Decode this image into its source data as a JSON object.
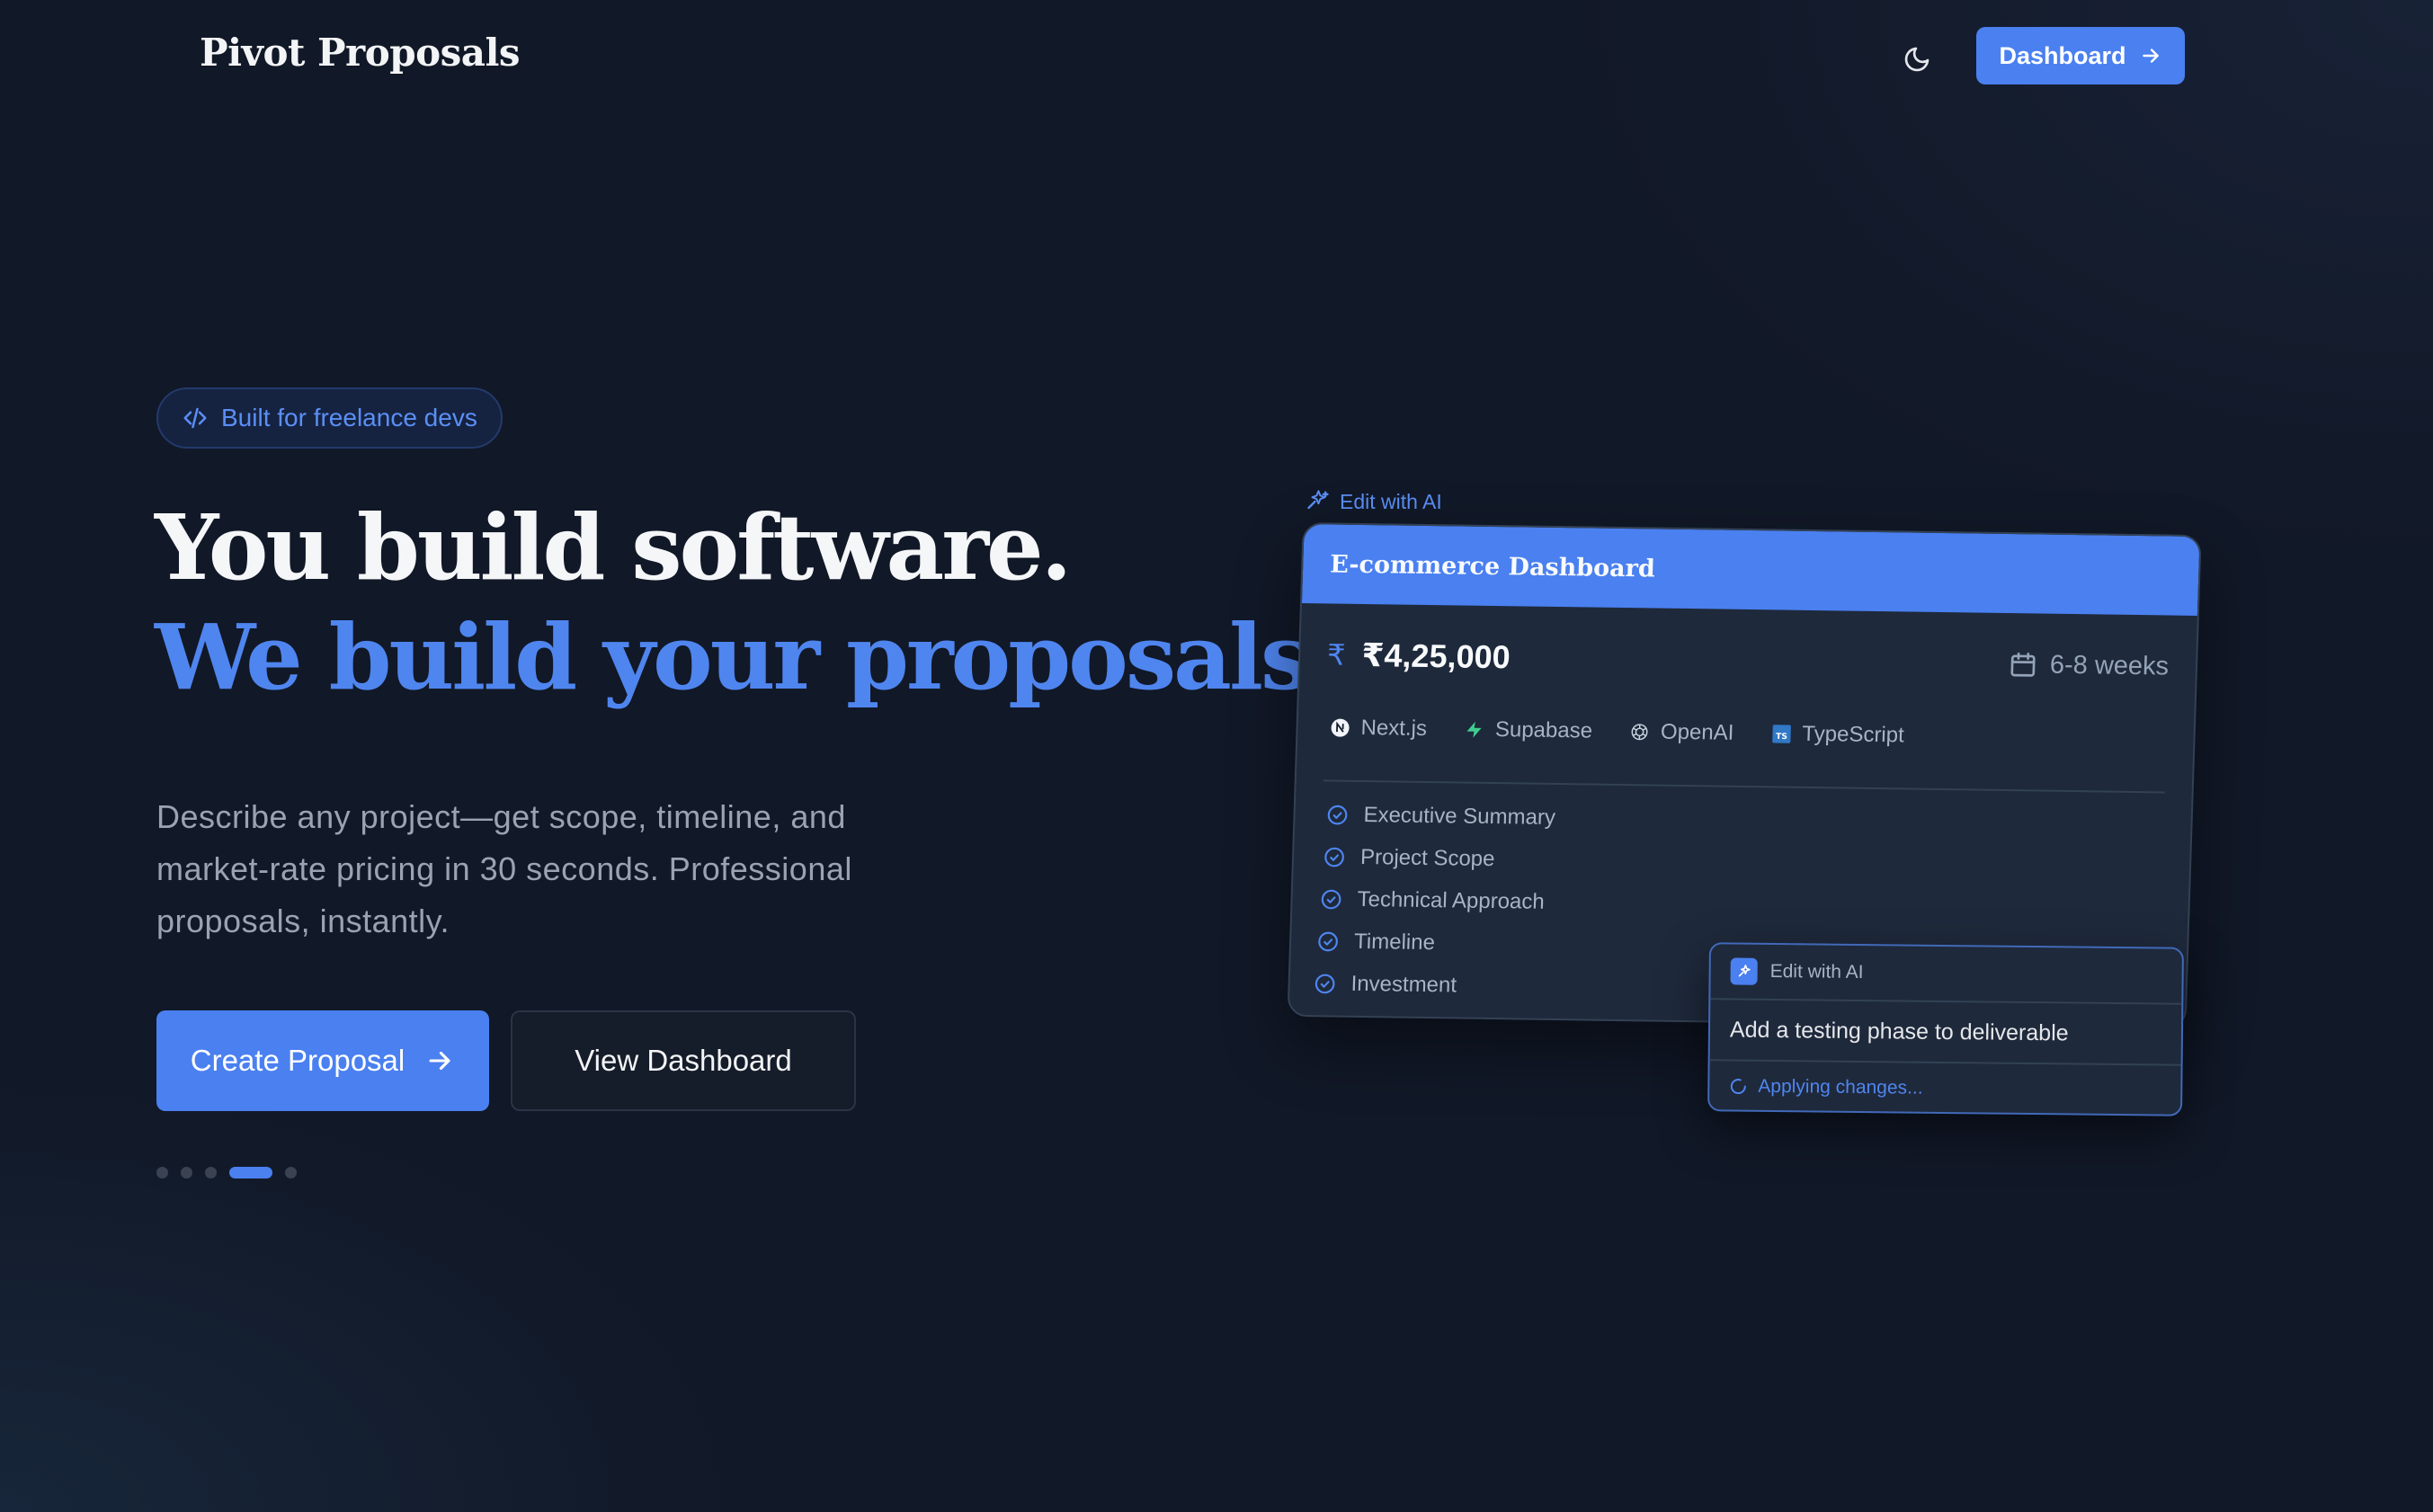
{
  "header": {
    "brand": "Pivot Proposals",
    "theme_toggle_icon": "moon-icon",
    "dashboard_label": "Dashboard"
  },
  "hero": {
    "pill_label": "Built for freelance devs",
    "headline_line1": "You build software.",
    "headline_line2": "We build your proposals.",
    "description": "Describe any project—get scope, timeline, and market-rate pricing in 30 seconds. Professional proposals, instantly.",
    "primary_cta": "Create Proposal",
    "secondary_cta": "View Dashboard",
    "carousel": {
      "total": 5,
      "active_index": 3
    }
  },
  "preview": {
    "edit_label": "Edit with AI",
    "card_title": "E-commerce Dashboard",
    "price": "₹4,25,000",
    "currency_symbol": "₹",
    "duration": "6-8 weeks",
    "tech_stack": [
      "Next.js",
      "Supabase",
      "OpenAI",
      "TypeScript"
    ],
    "sections": [
      "Executive Summary",
      "Project Scope",
      "Technical Approach",
      "Timeline",
      "Investment"
    ],
    "ai_box": {
      "title": "Edit with AI",
      "input_text": "Add a testing phase to deliverable",
      "status": "Applying changes..."
    }
  },
  "colors": {
    "background": "#111827",
    "accent": "#4a80f0",
    "card": "#1e293b",
    "muted_text": "#9aa3b2"
  }
}
